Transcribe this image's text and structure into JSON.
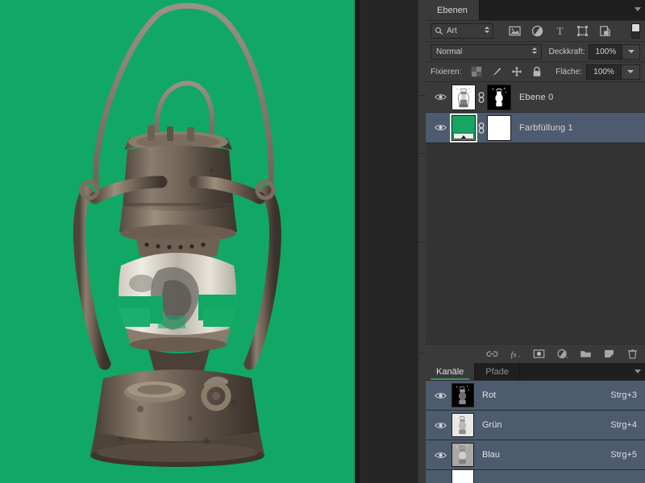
{
  "canvas": {
    "background_color": "#10a864",
    "image_subject": "rusty-kerosene-lantern",
    "gutter_color": "#1b1b1b"
  },
  "layers_panel": {
    "tabs": [
      {
        "label": "Ebenen",
        "active": true
      }
    ],
    "menu_icon": "panel-menu-icon",
    "filter": {
      "kind_label": "Art",
      "search_icon": "search-icon",
      "type_filters": [
        {
          "name": "pixel-layer-filter-icon",
          "glyph": "image"
        },
        {
          "name": "adjustment-layer-filter-icon",
          "glyph": "adjustment"
        },
        {
          "name": "type-layer-filter-icon",
          "glyph": "T"
        },
        {
          "name": "shape-layer-filter-icon",
          "glyph": "shape"
        },
        {
          "name": "smart-object-filter-icon",
          "glyph": "smart-object"
        }
      ],
      "toggle_name": "filter-enable-toggle"
    },
    "blend_mode": "Normal",
    "opacity_label": "Deckkraft:",
    "opacity_value": "100%",
    "lock_label": "Fixieren:",
    "lock_icons": [
      {
        "name": "lock-transparent-pixels-icon"
      },
      {
        "name": "lock-image-pixels-icon"
      },
      {
        "name": "lock-position-icon"
      },
      {
        "name": "lock-all-icon"
      }
    ],
    "fill_label": "Fläche:",
    "fill_value": "100%",
    "layers": [
      {
        "name": "Ebene 0",
        "visible": true,
        "selected": false,
        "has_link": true,
        "thumbnail": "lantern-on-white",
        "mask_thumbnail": "lantern-mask-black"
      },
      {
        "name": "Farbfüllung 1",
        "visible": true,
        "selected": true,
        "has_link": true,
        "thumbnail": "solid-green-fill",
        "mask_thumbnail": "white-mask",
        "fill_color": "#18a564"
      }
    ],
    "toolbar": [
      {
        "name": "link-layers-icon",
        "label": "Ebenen verknüpfen"
      },
      {
        "name": "layer-style-fx-icon",
        "label": "fx"
      },
      {
        "name": "add-layer-mask-icon",
        "label": "Ebenenmaske hinzufügen"
      },
      {
        "name": "new-adjustment-layer-icon",
        "label": "Neue Füll- oder Einstellungsebene"
      },
      {
        "name": "new-group-icon",
        "label": "Neue Gruppe"
      },
      {
        "name": "new-layer-icon",
        "label": "Neue Ebene"
      },
      {
        "name": "delete-layer-icon",
        "label": "Ebene löschen"
      }
    ]
  },
  "channels_panel": {
    "tabs": [
      {
        "label": "Kanäle",
        "active": true
      },
      {
        "label": "Pfade",
        "active": false
      }
    ],
    "menu_icon": "panel-menu-icon",
    "channels": [
      {
        "name": "Rot",
        "shortcut": "Strg+3",
        "visible": true,
        "selected": true,
        "thumbnail": "red-channel-dark"
      },
      {
        "name": "Grün",
        "shortcut": "Strg+4",
        "visible": true,
        "selected": true,
        "thumbnail": "green-channel-light"
      },
      {
        "name": "Blau",
        "shortcut": "Strg+5",
        "visible": true,
        "selected": true,
        "thumbnail": "blue-channel-mid"
      },
      {
        "name": "",
        "shortcut": "",
        "visible": false,
        "selected": true,
        "thumbnail": "alpha-channel-white"
      }
    ]
  },
  "colors": {
    "panel_bg": "#333333",
    "header_bg": "#3a3a3a",
    "tab_inactive_bg": "#1f1f1f",
    "selection_blue": "#4c5b6e",
    "canvas_green": "#10a864",
    "text_primary": "#d6d6d6"
  }
}
